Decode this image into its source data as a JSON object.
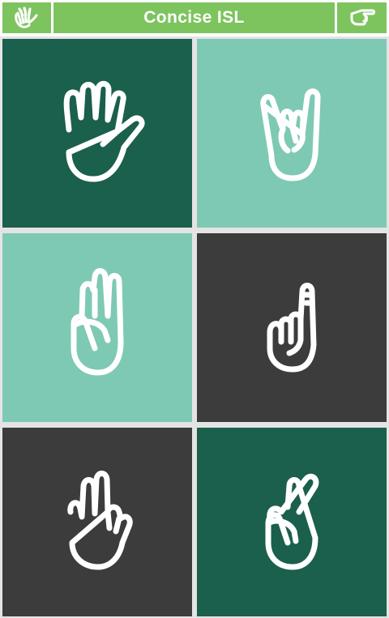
{
  "header": {
    "title": "Concise ISL",
    "left_icon": "hands-icon",
    "right_icon": "pointing-hand-icon",
    "color": "#7dc45f"
  },
  "tiles": [
    {
      "icon": "open-hand-icon",
      "color": "#1b5f4d"
    },
    {
      "icon": "pinky-up-hand-icon",
      "color": "#7ec9b4"
    },
    {
      "icon": "three-fingers-hand-icon",
      "color": "#7ec9b4"
    },
    {
      "icon": "pinky-fist-hand-icon",
      "color": "#3c3c3c"
    },
    {
      "icon": "two-fingers-hand-icon",
      "color": "#3c3c3c"
    },
    {
      "icon": "crossed-fingers-hand-icon",
      "color": "#1b5f4d"
    }
  ]
}
